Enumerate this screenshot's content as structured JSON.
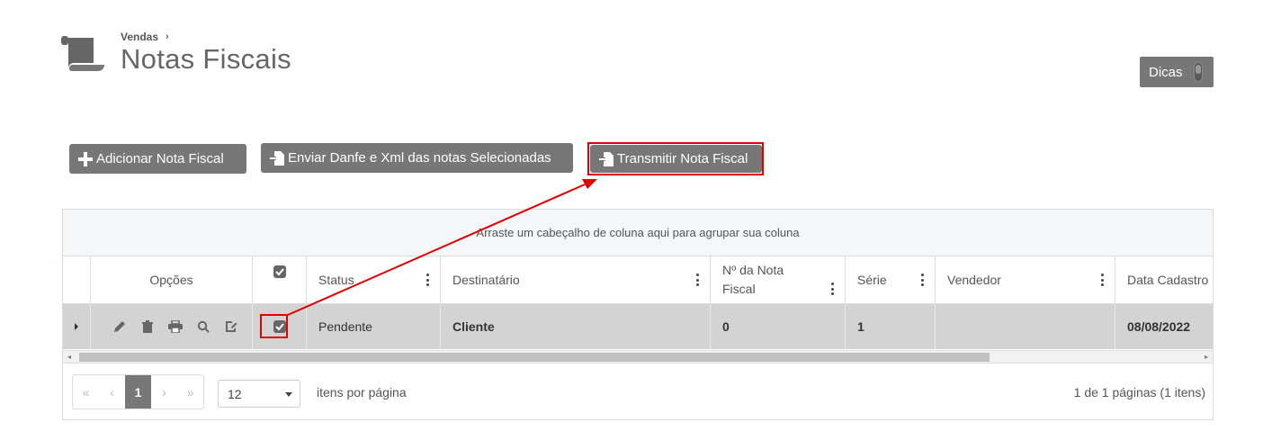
{
  "header": {
    "breadcrumb": "Vendas",
    "breadcrumb_sep": "›",
    "title": "Notas Fiscais",
    "icon": "scroll-icon"
  },
  "dicas": {
    "label": "Dicas"
  },
  "toolbar": {
    "add_label": "Adicionar Nota Fiscal",
    "send_label": "Enviar Danfe e Xml das notas Selecionadas",
    "transmit_label": "Transmitir Nota Fiscal"
  },
  "grid": {
    "group_hint": "Arraste um cabeçalho de coluna aqui para agrupar sua coluna",
    "columns": {
      "opcoes": "Opções",
      "status": "Status",
      "destinatario": "Destinatário",
      "numero": "Nº da Nota Fiscal",
      "serie": "Série",
      "vendedor": "Vendedor",
      "data_cadastro": "Data Cadastro"
    },
    "rows": [
      {
        "status": "Pendente",
        "destinatario": "Cliente",
        "numero": "0",
        "serie": "1",
        "vendedor": "",
        "data_cadastro": "08/08/2022",
        "checked": true
      }
    ]
  },
  "pager": {
    "first": "«",
    "prev": "‹",
    "current_page": "1",
    "next": "›",
    "last": "»",
    "page_size": "12",
    "page_size_label": "itens por página",
    "info": "1 de 1 páginas (1 itens)"
  },
  "colors": {
    "button_bg": "#777777",
    "highlight": "#e00000",
    "row_bg": "#d3d3d3"
  }
}
